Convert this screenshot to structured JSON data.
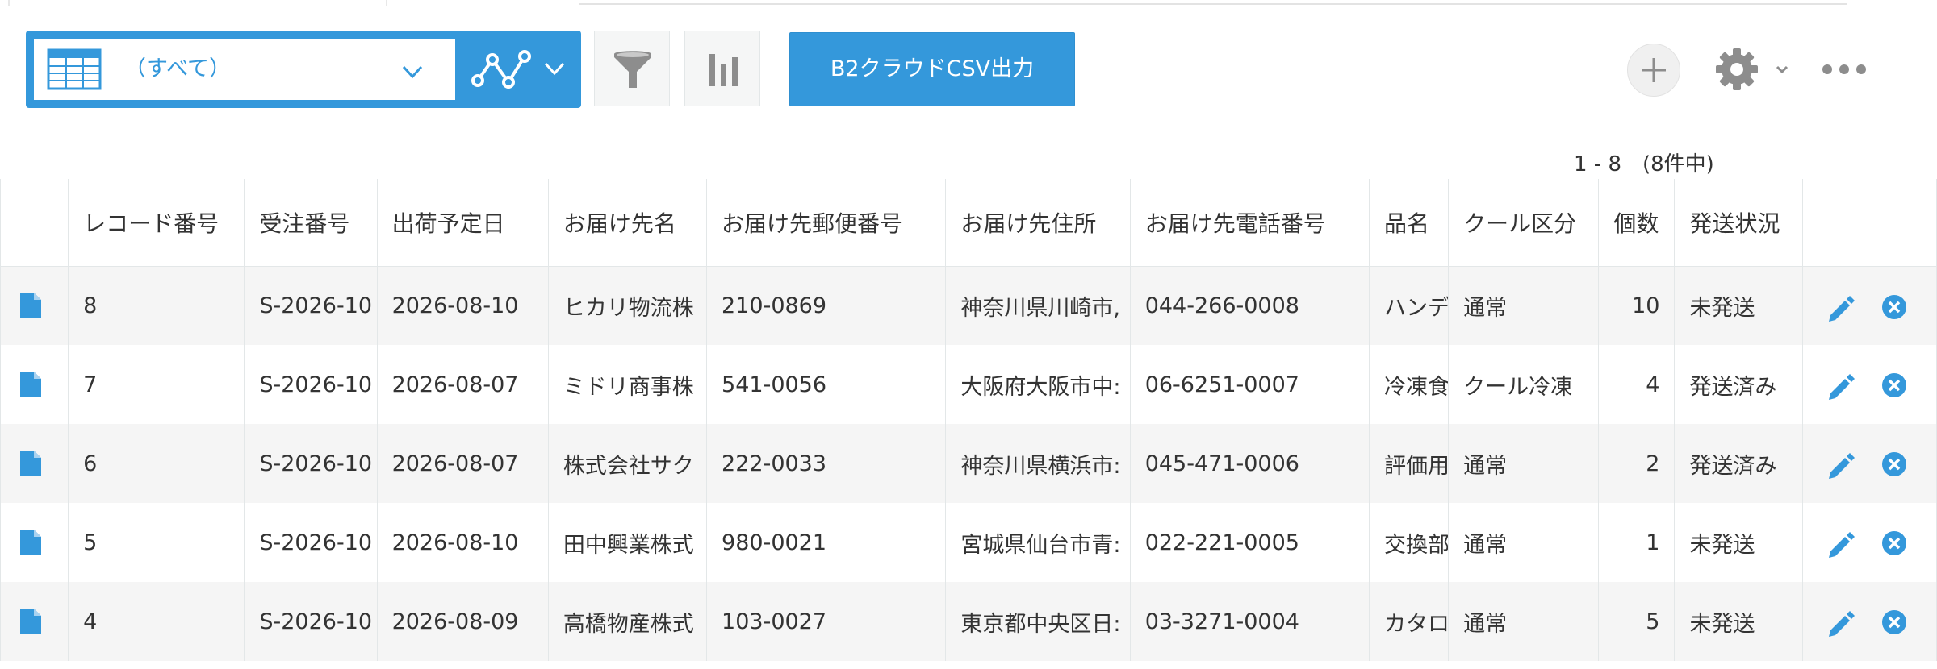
{
  "view": {
    "selected": "（すべて）",
    "icons": {
      "table": "table-icon",
      "graph": "graph-icon",
      "dropdown": "chevron-down-icon"
    }
  },
  "toolbar": {
    "filter_icon": "filter-icon",
    "chart_icon": "bar-chart-icon",
    "csv_button_label": "B2クラウドCSV出力",
    "add_icon": "plus-icon",
    "settings_icon": "gear-icon",
    "more_icon": "more-icon"
  },
  "pagination": {
    "text": "1 - 8　(8件中)"
  },
  "colors": {
    "accent": "#3498db",
    "delete": "#3498db",
    "row_alt": "#f5f5f5"
  },
  "table": {
    "columns": [
      "",
      "レコード番号",
      "受注番号",
      "出荷予定日",
      "お届け先名",
      "お届け先郵便番号",
      "お届け先住所",
      "お届け先電話番号",
      "品名",
      "クール区分",
      "個数",
      "発送状況",
      ""
    ],
    "rows": [
      {
        "record_no": "8",
        "order_no": "S-2026-10",
        "ship_date": "2026-08-10",
        "name": "ヒカリ物流株",
        "zip": "210-0869",
        "address": "神奈川県川崎市,",
        "phone": "044-266-0008",
        "item": "ハンデ",
        "cool": "通常",
        "qty": "10",
        "status": "未発送"
      },
      {
        "record_no": "7",
        "order_no": "S-2026-10",
        "ship_date": "2026-08-07",
        "name": "ミドリ商事株",
        "zip": "541-0056",
        "address": "大阪府大阪市中:",
        "phone": "06-6251-0007",
        "item": "冷凍食",
        "cool": "クール冷凍",
        "qty": "4",
        "status": "発送済み"
      },
      {
        "record_no": "6",
        "order_no": "S-2026-10",
        "ship_date": "2026-08-07",
        "name": "株式会社サク",
        "zip": "222-0033",
        "address": "神奈川県横浜市:",
        "phone": "045-471-0006",
        "item": "評価用",
        "cool": "通常",
        "qty": "2",
        "status": "発送済み"
      },
      {
        "record_no": "5",
        "order_no": "S-2026-10",
        "ship_date": "2026-08-10",
        "name": "田中興業株式",
        "zip": "980-0021",
        "address": "宮城県仙台市青:",
        "phone": "022-221-0005",
        "item": "交換部",
        "cool": "通常",
        "qty": "1",
        "status": "未発送"
      },
      {
        "record_no": "4",
        "order_no": "S-2026-10",
        "ship_date": "2026-08-09",
        "name": "高橋物産株式",
        "zip": "103-0027",
        "address": "東京都中央区日:",
        "phone": "03-3271-0004",
        "item": "カタロ",
        "cool": "通常",
        "qty": "5",
        "status": "未発送"
      }
    ]
  }
}
